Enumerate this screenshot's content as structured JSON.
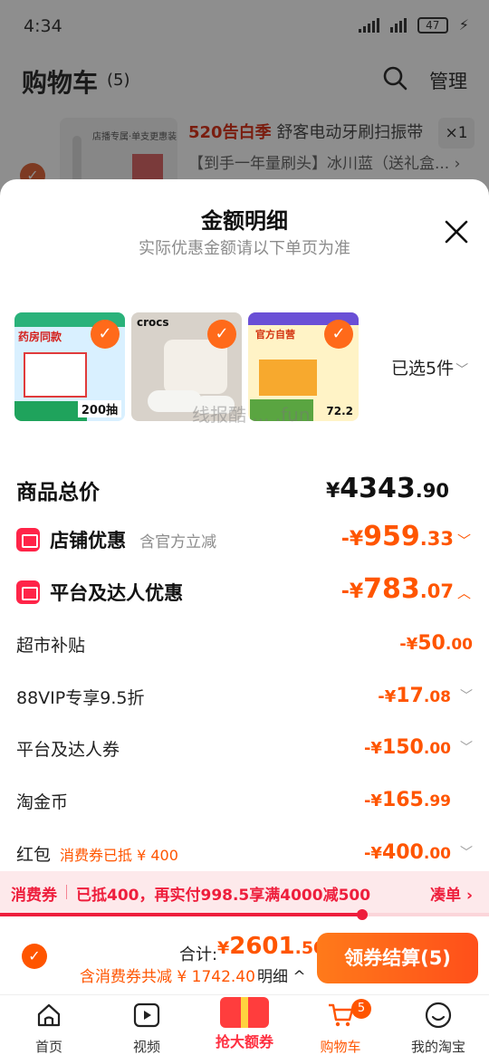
{
  "status_bar": {
    "time": "4:34",
    "battery": "47"
  },
  "cart_page": {
    "title": "购物车",
    "count": "(5)",
    "manage": "管理",
    "item": {
      "image_tag": "店播专属·单支更惠装",
      "promo_tag": "520告白季",
      "name": "舒客电动牙刷扫振带",
      "variant": "【到手一年量刷头】冰川蓝（送礼盒...",
      "quantity": "×1"
    }
  },
  "sheet": {
    "title": "金额明细",
    "subtitle": "实际优惠金额请以下单页为准",
    "selected_text": "已选5件",
    "watermark": "线报酷 ... .fun",
    "thumbnails": [
      {
        "label": "药房同款",
        "qty": "200抽"
      },
      {
        "brand": "crocs"
      },
      {
        "header": "官方自营",
        "price": "72.2"
      }
    ],
    "total": {
      "label": "商品总价",
      "yen": "¥",
      "int": "4343",
      "dec": ".90"
    },
    "shop_discount": {
      "label": "店铺优惠",
      "note": "含官方立减",
      "sign": "-¥",
      "int": "959",
      "dec": ".33"
    },
    "platform_discount": {
      "label": "平台及达人优惠",
      "sign": "-¥",
      "int": "783",
      "dec": ".07"
    },
    "sub_items": [
      {
        "label": "超市补贴",
        "sign": "-¥",
        "int": "50",
        "dec": ".00"
      },
      {
        "label": "88VIP专享9.5折",
        "sign": "-¥",
        "int": "17",
        "dec": ".08"
      },
      {
        "label": "平台及达人券",
        "sign": "-¥",
        "int": "150",
        "dec": ".00"
      },
      {
        "label": "淘金币",
        "sign": "-¥",
        "int": "165",
        "dec": ".99"
      },
      {
        "label": "红包",
        "hint": "消费券已抵 ¥ 400",
        "sign": "-¥",
        "int": "400",
        "dec": ".00"
      }
    ],
    "coupon_bar": {
      "title": "消费券",
      "message": "已抵400，再实付998.5享满4000减500",
      "action": "凑单 ›",
      "progress": 0.74
    }
  },
  "checkout": {
    "sum_label": "合计:",
    "sum_yen": "¥",
    "sum_int": "2601",
    "sum_dec": ".50",
    "saving_note": "含消费券共减 ¥ 1742.40",
    "detail_label": "明细 ^",
    "pay_button": "领券结算(5)"
  },
  "tabbar": {
    "home": "首页",
    "video": "视频",
    "promo": "抢大额券",
    "cart": "购物车",
    "cart_badge": "5",
    "me": "我的淘宝"
  },
  "colors": {
    "accent": "#ff5500",
    "coupon_red": "#ee1e3c",
    "badge_red": "#ff2448"
  }
}
